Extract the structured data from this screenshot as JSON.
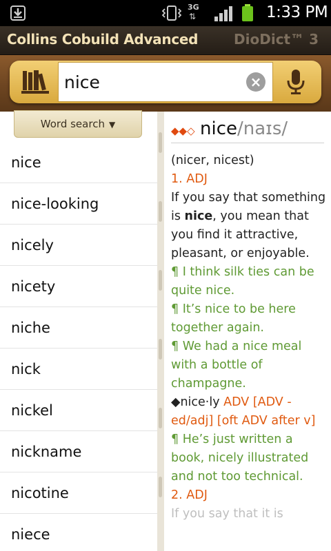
{
  "status": {
    "time": "1:33 PM",
    "network": "3G"
  },
  "title": {
    "app": "Collins Cobuild Advanced",
    "brand": "DioDict™ 3"
  },
  "search": {
    "value": "nice",
    "clear_glyph": "×"
  },
  "left": {
    "tab_label": "Word search",
    "words": [
      "nice",
      "nice-looking",
      "nicely",
      "nicety",
      "niche",
      "nick",
      "nickel",
      "nickname",
      "nicotine",
      "niece"
    ]
  },
  "entry": {
    "stars": "◆◆◇",
    "headword": "nice",
    "pron": "/naɪs/",
    "inflections": "(nicer, nicest)",
    "sense1": "1. ADJ",
    "def1_a": "If you say that something is ",
    "def1_bold": "nice",
    "def1_b": ", you mean that you find it attractive, pleasant, or enjoyable.",
    "ex1": "¶ I think silk ties can be quite nice.",
    "ex2": "¶ It’s nice to be here together again.",
    "ex3": "¶ We had a nice meal with a bottle of champagne.",
    "deriv_word": "◆nice·ly ",
    "deriv_pos": "ADV [ADV -ed/adj] [oft ADV after v]",
    "ex4": "¶ He’s just written a book, nicely illustrated and not too technical.",
    "sense2": "2. ADJ",
    "def2": "If you say that it is"
  },
  "colors": {
    "accent": "#e05a10",
    "example": "#5f9a34",
    "wood": "#6d4521",
    "gold": "#e2b450"
  }
}
